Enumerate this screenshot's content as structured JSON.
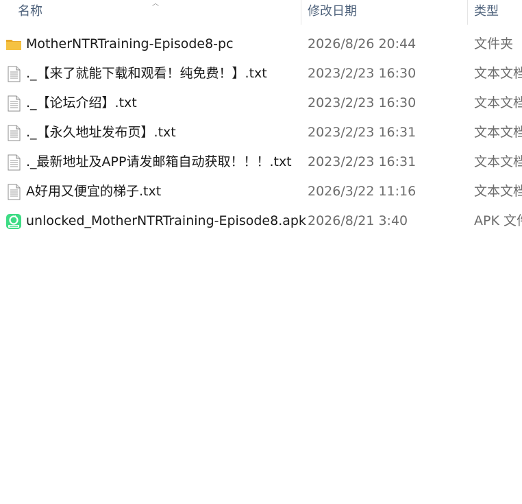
{
  "header": {
    "name_label": "名称",
    "date_label": "修改日期",
    "type_label": "类型"
  },
  "files": [
    {
      "name": "MotherNTRTraining-Episode8-pc",
      "modified": "2026/8/26 20:44",
      "type": "文件夹",
      "icon": "folder-icon"
    },
    {
      "name": "._【来了就能下载和观看！纯免费！】.txt",
      "modified": "2023/2/23 16:30",
      "type": "文本文档",
      "icon": "text-file-icon"
    },
    {
      "name": "._【论坛介绍】.txt",
      "modified": "2023/2/23 16:30",
      "type": "文本文档",
      "icon": "text-file-icon"
    },
    {
      "name": "._【永久地址发布页】.txt",
      "modified": "2023/2/23 16:31",
      "type": "文本文档",
      "icon": "text-file-icon"
    },
    {
      "name": "._最新地址及APP请发邮箱自动获取！！！.txt",
      "modified": "2023/2/23 16:31",
      "type": "文本文档",
      "icon": "text-file-icon"
    },
    {
      "name": "A好用又便宜的梯子.txt",
      "modified": "2026/3/22 11:16",
      "type": "文本文档",
      "icon": "text-file-icon"
    },
    {
      "name": "unlocked_MotherNTRTraining-Episode8.apk",
      "modified": "2026/8/21 3:40",
      "type": "APK 文件",
      "icon": "apk-file-icon"
    }
  ],
  "colors": {
    "folder": "#f5c242",
    "apk": "#3ddc84",
    "header_text": "#4c607a",
    "secondary_text": "#6d6d6d"
  }
}
